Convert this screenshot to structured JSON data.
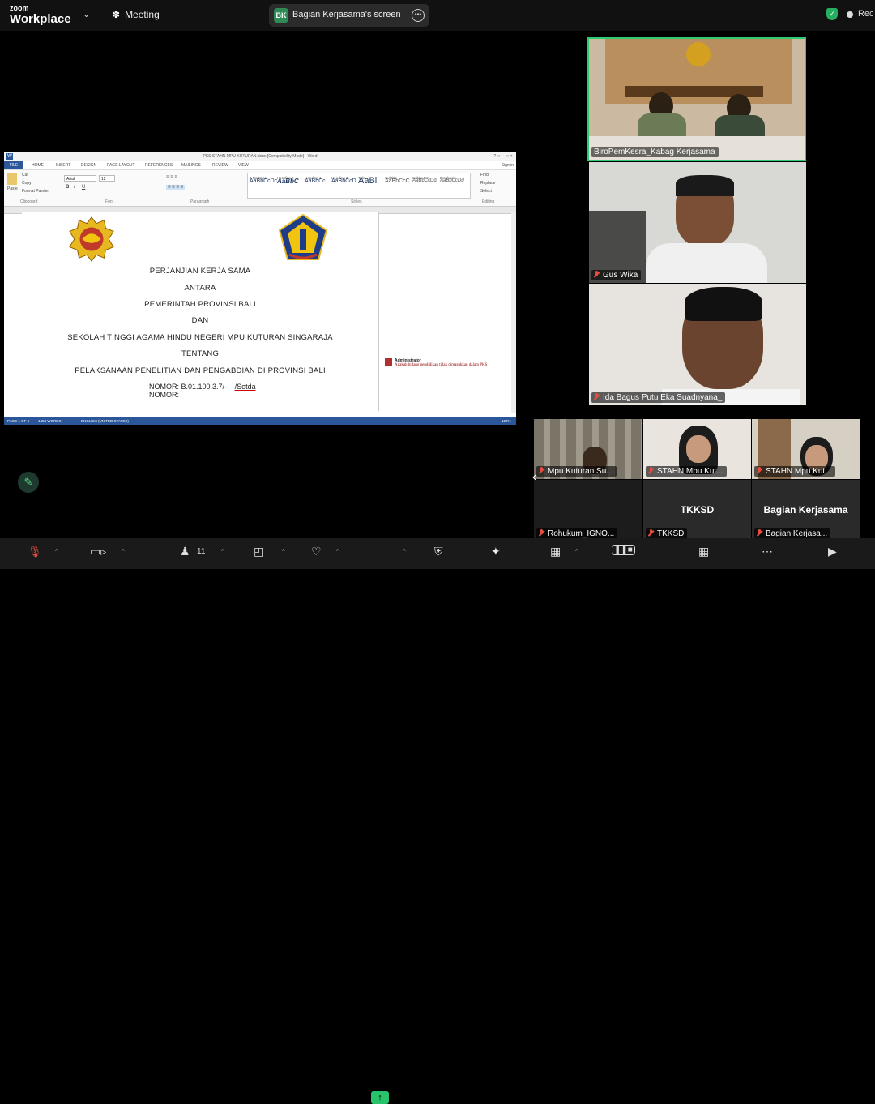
{
  "app": {
    "brand_top": "zoom",
    "brand_bottom": "Workplace",
    "meeting_label": "Meeting"
  },
  "screen_share": {
    "initials": "BK",
    "label": "Bagian Kerjasama's screen"
  },
  "recording": {
    "label": "Rec"
  },
  "word": {
    "title": "PKS STAHN MPU KUTURAN.docx [Compatibility Mode] - Word",
    "tabs": [
      "FILE",
      "HOME",
      "INSERT",
      "DESIGN",
      "PAGE LAYOUT",
      "REFERENCES",
      "MAILINGS",
      "REVIEW",
      "VIEW"
    ],
    "sign_in": "Sign in",
    "font_name": "Arial",
    "font_size": "12",
    "clipboard": {
      "cut": "Cut",
      "copy": "Copy",
      "format_painter": "Format Painter",
      "paste": "Paste"
    },
    "group_labels": [
      "Clipboard",
      "Font",
      "Paragraph",
      "Styles",
      "Editing"
    ],
    "styles": [
      {
        "sample": "AaBbCcDc",
        "name": "¶ No Spac..."
      },
      {
        "sample": "AaBbC",
        "name": "Heading 2"
      },
      {
        "sample": "AaBbCc",
        "name": "Heading 1"
      },
      {
        "sample": "AaBbCcD",
        "name": "Heading 3"
      },
      {
        "sample": "AaBl",
        "name": "Title"
      },
      {
        "sample": "AaBbCcC",
        "name": "Subtitle"
      },
      {
        "sample": "AaBbCcDd",
        "name": "Subtle Em..."
      },
      {
        "sample": "AaBbCcDd",
        "name": "Emphasis"
      }
    ],
    "editing": {
      "find": "Find",
      "replace": "Replace",
      "select": "Select"
    },
    "document": {
      "lines": [
        "PERJANJIAN KERJA SAMA",
        "ANTARA",
        "PEMERINTAH PROVINSI BALI",
        "DAN",
        "SEKOLAH TINGGI AGAMA HINDU NEGERI MPU KUTURAN SINGARAJA",
        "TENTANG",
        "PELAKSANAAN PENELITIAN DAN PENGABDIAN DI PROVINSI BALI"
      ],
      "nomor1": "NOMOR: B.01.100.3.7/",
      "nomor1_suffix": "/Setda",
      "nomor2": "NOMOR:"
    },
    "comment": {
      "author": "Administrator",
      "text": "Apakah bidang pendidikan tidak dimasukkan dalam PKS"
    },
    "status": {
      "page": "PAGE 1 OF 6",
      "words": "1453 WORDS",
      "language": "ENGLISH (UNITED STATES)",
      "zoom": "120%"
    }
  },
  "participants": {
    "tile1": "BiroPemKesra_Kabag Kerjasama",
    "tile2": "Gus Wika",
    "tile3": "Ida Bagus Putu Eka Suadnyana_",
    "strip": [
      {
        "name": "Mpu Kuturan Su...",
        "big": ""
      },
      {
        "name": "STAHN Mpu Kut...",
        "big": ""
      },
      {
        "name": "STAHN Mpu Kut...",
        "big": ""
      },
      {
        "name": "Rohukum_IGNO...",
        "big": ""
      },
      {
        "name": "TKKSD",
        "big": "TKKSD"
      },
      {
        "name": "Bagian Kerjasa...",
        "big": "Bagian Kerjasama"
      }
    ]
  },
  "toolbar": {
    "participant_count": "11"
  },
  "colors": {
    "word_blue": "#2b579a",
    "active_speaker": "#2ecc71",
    "share_green": "#27c46b",
    "muted_red": "#e74c3c"
  }
}
